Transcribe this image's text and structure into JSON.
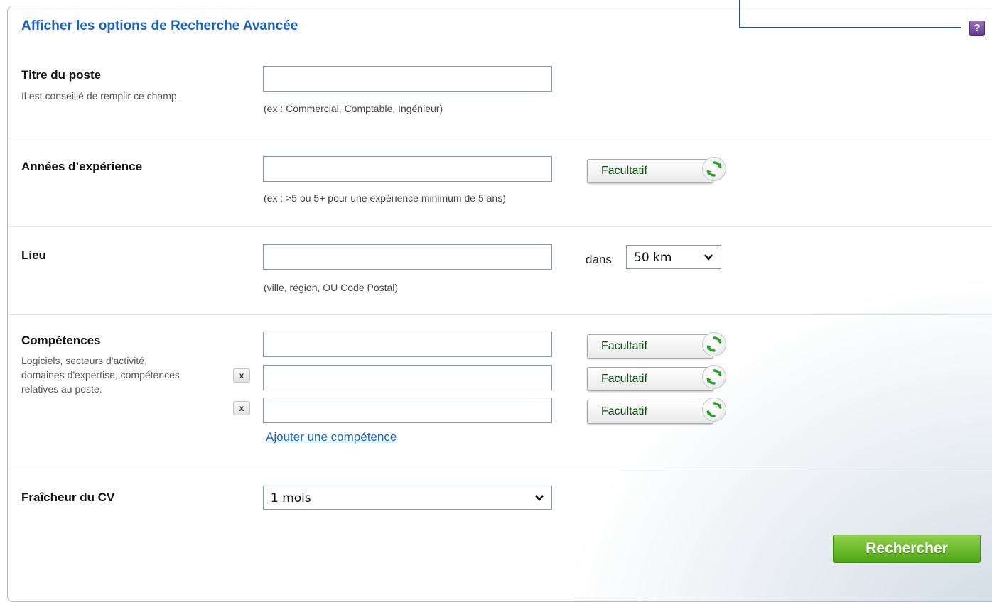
{
  "header": {
    "advanced_search_link": "Afficher les options de Recherche Avancée",
    "help_icon_text": "?"
  },
  "job_title": {
    "label": "Titre du poste",
    "sublabel": "Il est conseillé de remplir ce champ.",
    "value": "",
    "hint": "(ex : Commercial, Comptable, Ingénieur)"
  },
  "experience": {
    "label": "Années d’expérience",
    "value": "",
    "hint": "(ex : >5 ou 5+ pour une expérience minimum de 5 ans)",
    "option_label": "Facultatif"
  },
  "location": {
    "label": "Lieu",
    "value": "",
    "hint": "(ville, région, OU Code Postal)",
    "radius_prefix": "dans",
    "radius_value": "50 km"
  },
  "skills": {
    "label": "Compétences",
    "sublabel": "Logiciels, secteurs d'activité, domaines d'expertise, compétences relatives au poste.",
    "rows": [
      {
        "value": "",
        "option_label": "Facultatif"
      },
      {
        "value": "",
        "option_label": "Facultatif",
        "remove_label": "x"
      },
      {
        "value": "",
        "option_label": "Facultatif",
        "remove_label": "x"
      }
    ],
    "add_link": "Ajouter une compétence"
  },
  "freshness": {
    "label": "Fraîcheur du CV",
    "value": "1 mois"
  },
  "search_button": "Rechercher",
  "colors": {
    "link": "#1a62c8",
    "button_green": "#4da517",
    "option_text": "#0e4f10",
    "help_purple": "#5f3a8e"
  },
  "icons": {
    "help": "question-mark-icon",
    "refresh": "refresh-arrows-icon",
    "remove": "close-icon",
    "dropdown": "chevron-down-icon"
  }
}
